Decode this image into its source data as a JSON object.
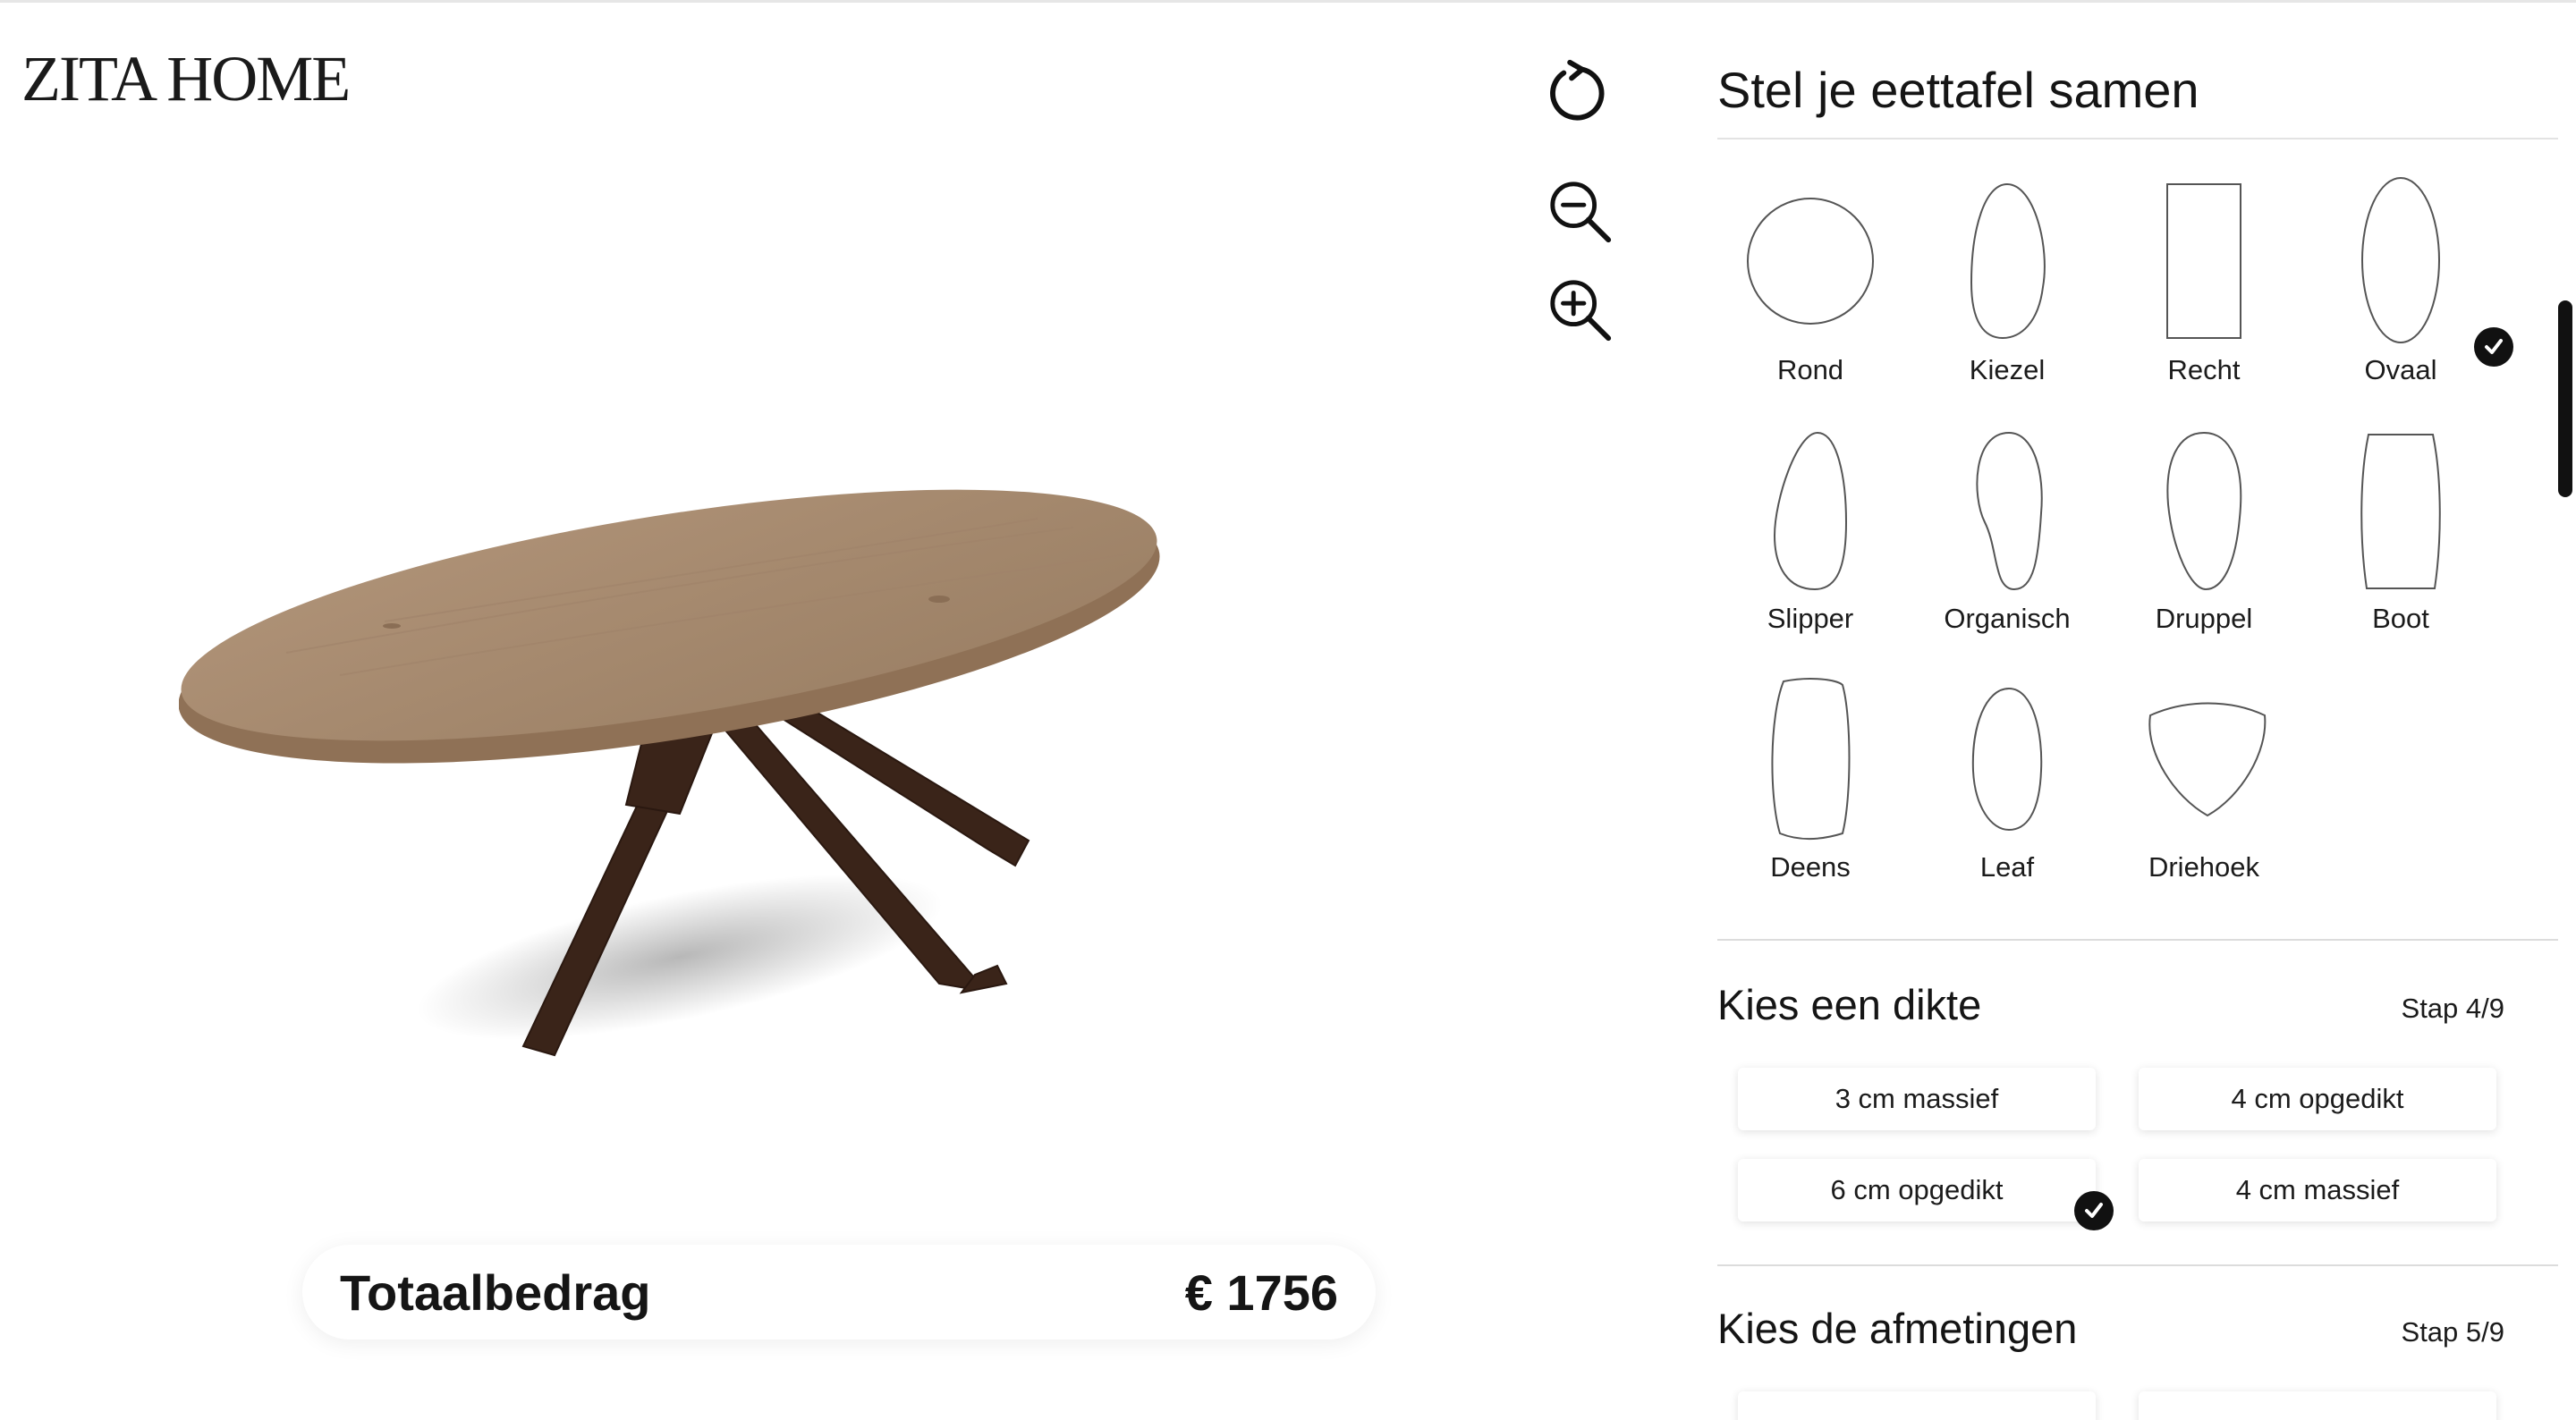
{
  "brand": {
    "logo_text": "ZITA HOME"
  },
  "viewer": {
    "tools": [
      {
        "name": "rotate-icon"
      },
      {
        "name": "zoom-out-icon"
      },
      {
        "name": "zoom-in-icon"
      }
    ],
    "colors": {
      "tabletop": "#a4886c",
      "legs": "#3a2419"
    }
  },
  "total": {
    "label": "Totaalbedrag",
    "value": "€ 1756"
  },
  "configurator": {
    "title": "Stel je eettafel samen",
    "shapes": [
      {
        "label": "Rond"
      },
      {
        "label": "Kiezel"
      },
      {
        "label": "Recht"
      },
      {
        "label": "Ovaal",
        "selected": true
      },
      {
        "label": "Slipper"
      },
      {
        "label": "Organisch"
      },
      {
        "label": "Druppel"
      },
      {
        "label": "Boot"
      },
      {
        "label": "Deens"
      },
      {
        "label": "Leaf"
      },
      {
        "label": "Driehoek"
      }
    ],
    "thickness": {
      "title": "Kies een dikte",
      "step": "Stap 4/9",
      "options": [
        {
          "label": "3 cm massief"
        },
        {
          "label": "4 cm opgedikt"
        },
        {
          "label": "6 cm opgedikt",
          "selected": true
        },
        {
          "label": "4 cm massief"
        }
      ]
    },
    "dimensions": {
      "title": "Kies de afmetingen",
      "step": "Stap 5/9"
    }
  }
}
